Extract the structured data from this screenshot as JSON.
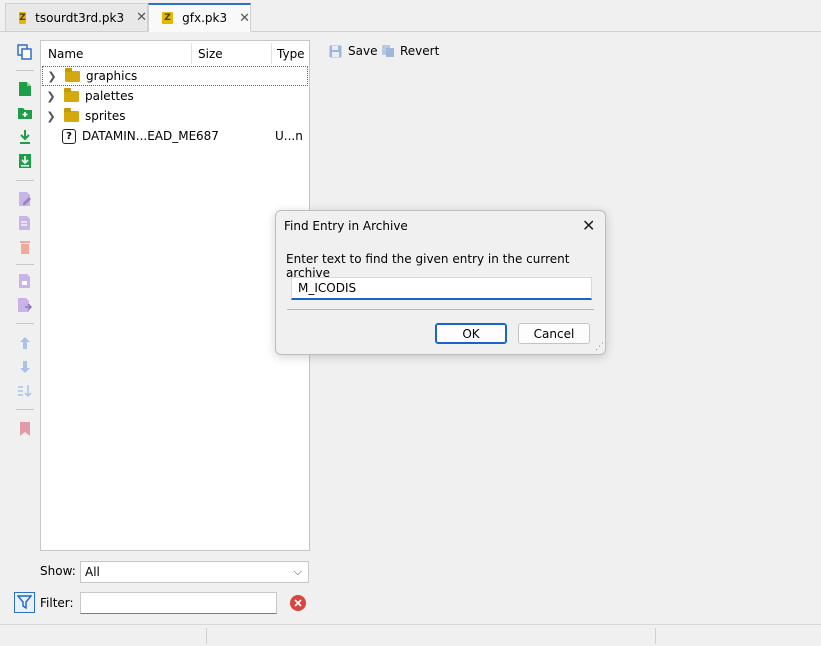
{
  "tabs": [
    {
      "label": "tsourdt3rd.pk3",
      "icon": "zip-archive-icon",
      "close": "✕"
    },
    {
      "label": "gfx.pk3",
      "icon": "zip-archive-icon",
      "close": "✕"
    }
  ],
  "archive": {
    "columns": {
      "name": "Name",
      "size": "Size",
      "type": "Type"
    },
    "entries": [
      {
        "name": "graphics",
        "size": "",
        "type": "",
        "icon": "folder-icon"
      },
      {
        "name": "palettes",
        "size": "",
        "type": "",
        "icon": "folder-icon"
      },
      {
        "name": "sprites",
        "size": "",
        "type": "",
        "icon": "folder-icon"
      },
      {
        "name": "DATAMIN...EAD_ME",
        "size": "687",
        "type": "U...n",
        "icon": "unknown-file-icon"
      }
    ]
  },
  "filters": {
    "show_label": "Show:",
    "show_value": "All",
    "filter_label": "Filter:",
    "filter_value": ""
  },
  "entry_toolbar": {
    "save_label": "Save",
    "revert_label": "Revert"
  },
  "dialog": {
    "title": "Find Entry in Archive",
    "prompt": "Enter text to find the given entry in the current archive",
    "input_value": "M_ICODIS",
    "ok_label": "OK",
    "cancel_label": "Cancel"
  },
  "colors": {
    "accent": "#1d63c7",
    "folder": "#d3a90d",
    "archive_badge": "#e4b800"
  }
}
